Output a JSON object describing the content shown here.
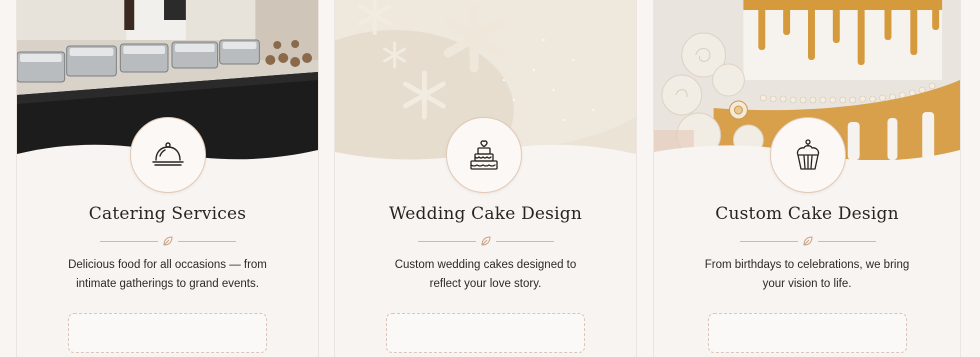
{
  "colors": {
    "accent": "#d9b59d",
    "title": "#2a2420",
    "card_bg": "#f8f4f1",
    "icon_stroke": "#2a2420"
  },
  "services": [
    {
      "title": "Catering Services",
      "description_line1": "Delicious food for all occasions — from",
      "description_line2": "intimate gatherings to grand events.",
      "icon": "cloche-icon",
      "image": "catering-buffet-photo",
      "button_label": ""
    },
    {
      "title": "Wedding Cake Design",
      "description_line1": "Custom wedding cakes designed to",
      "description_line2": "reflect your love story.",
      "icon": "tiered-cake-icon",
      "image": "snowflake-wedding-cake-photo",
      "button_label": ""
    },
    {
      "title": "Custom Cake Design",
      "description_line1": "From birthdays to celebrations, we bring",
      "description_line2": "your vision to life.",
      "icon": "cupcake-icon",
      "image": "gold-drip-cake-photo",
      "button_label": ""
    }
  ]
}
